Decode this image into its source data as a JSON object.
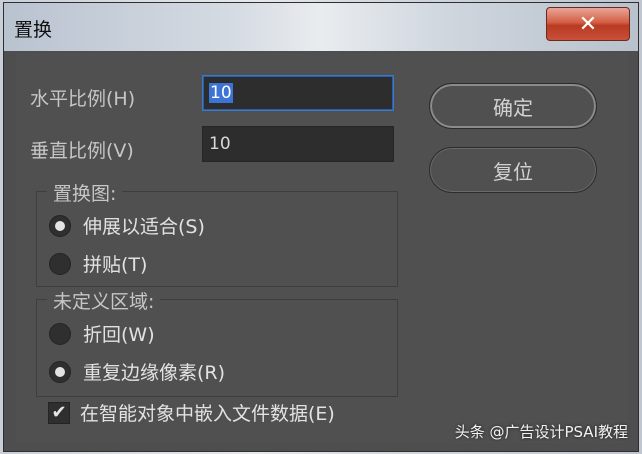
{
  "dialog": {
    "title": "置换",
    "close_glyph": "✕"
  },
  "fields": {
    "horizontal_label": "水平比例(H)",
    "horizontal_value": "10",
    "vertical_label": "垂直比例(V)",
    "vertical_value": "10"
  },
  "buttons": {
    "ok": "确定",
    "reset": "复位"
  },
  "displacement_map": {
    "title": "置换图:",
    "options": [
      {
        "label": "伸展以适合(S)",
        "selected": true
      },
      {
        "label": "拼贴(T)",
        "selected": false
      }
    ]
  },
  "undefined_areas": {
    "title": "未定义区域:",
    "options": [
      {
        "label": "折回(W)",
        "selected": false
      },
      {
        "label": "重复边缘像素(R)",
        "selected": true
      }
    ]
  },
  "embed_checkbox": {
    "label": "在智能对象中嵌入文件数据(E)",
    "checked": true,
    "glyph": "✔"
  },
  "watermark": "头条 @广告设计PSAI教程",
  "colors": {
    "dialog_bg": "#505050",
    "field_bg": "#2d2d2d",
    "focus_border": "#3d79c9",
    "close_button": "#c9503a"
  }
}
